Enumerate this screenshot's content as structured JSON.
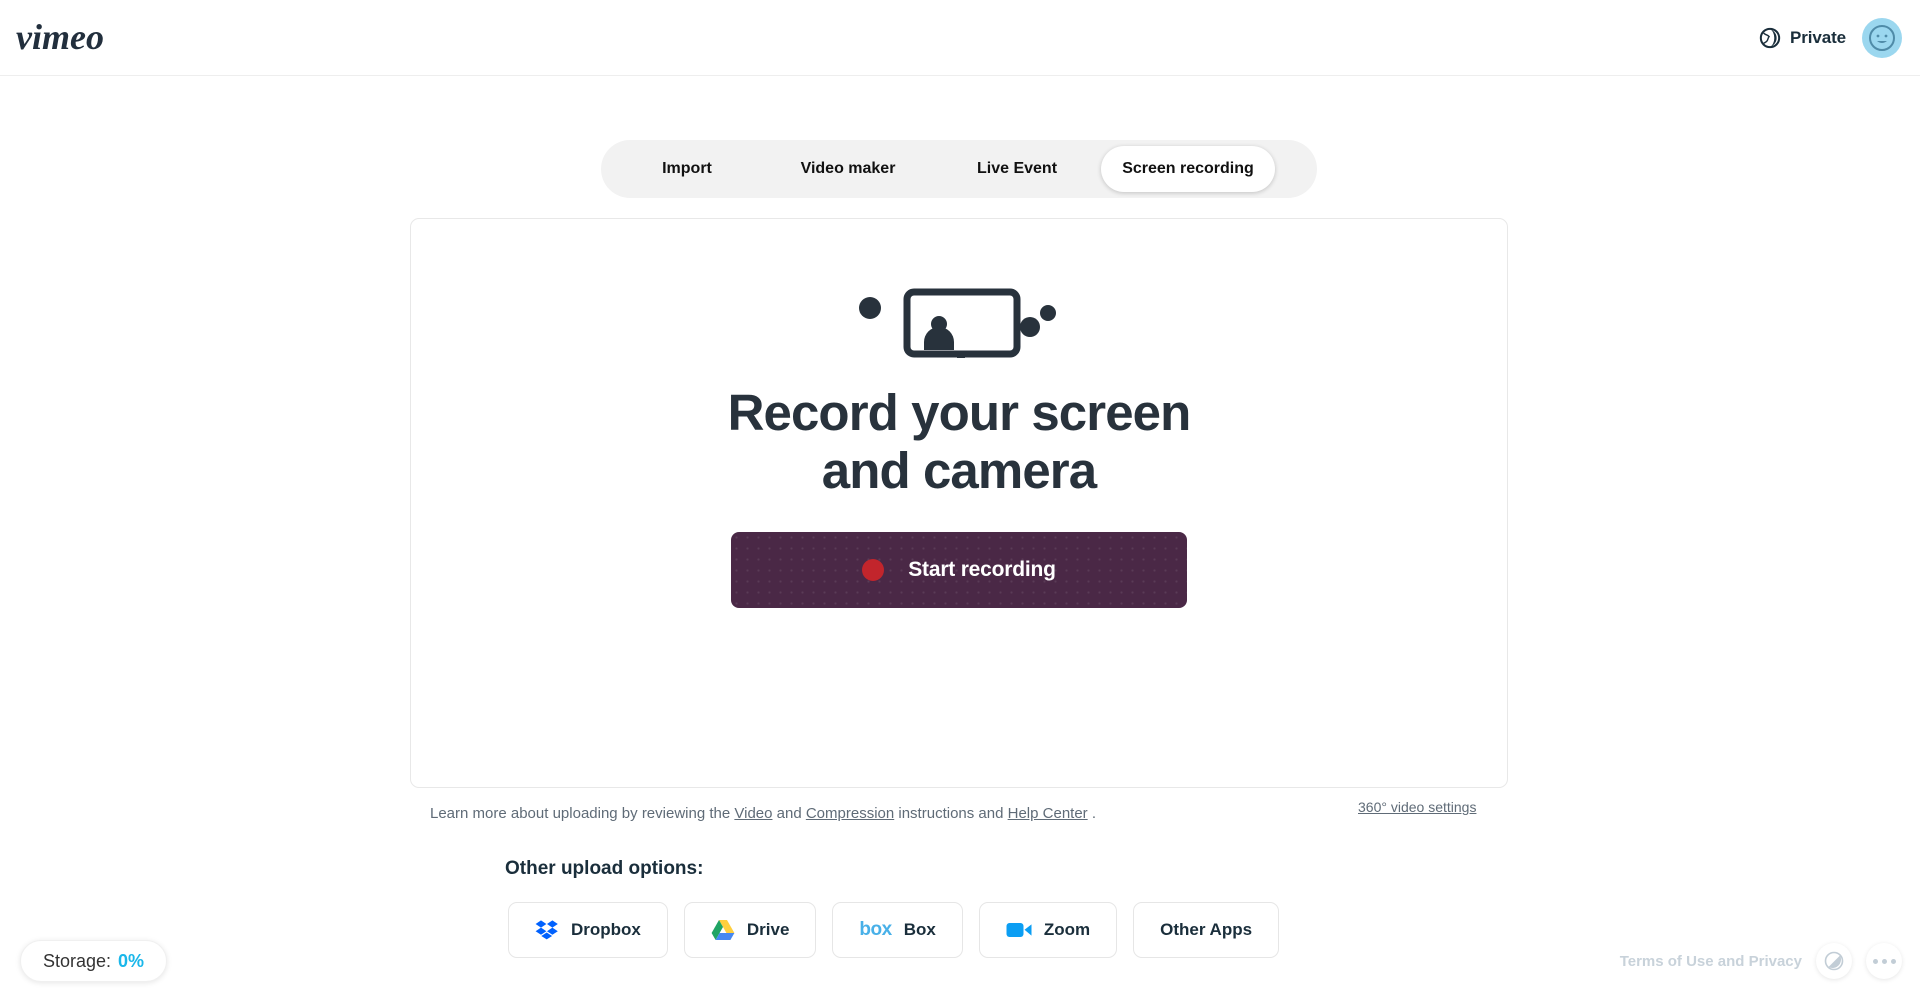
{
  "header": {
    "logo_text": "vimeo",
    "logo_icon": "vimeo-logo",
    "privacy_label": "Private",
    "privacy_icon": "globe-icon",
    "avatar_icon": "user-avatar-smiley"
  },
  "tabs": [
    {
      "label": "Import",
      "active": false
    },
    {
      "label": "Video maker",
      "active": false
    },
    {
      "label": "Live Event",
      "active": false
    },
    {
      "label": "Screen recording",
      "active": true
    }
  ],
  "main": {
    "hero_icon": "monitor-with-person-icon",
    "headline_line1": "Record your screen",
    "headline_line2": "and camera",
    "record_button_label": "Start recording",
    "record_button_icon": "record-dot-icon"
  },
  "links": {
    "learn_prefix": "Learn more about uploading by reviewing the ",
    "video_link": "Video",
    "and_1": " and ",
    "compression_link": "Compression",
    "instructions_text": " instructions and ",
    "help_center_link": "Help Center",
    "trailing_period": " .",
    "settings_360": "360° video settings"
  },
  "other_options": {
    "title": "Other upload options:",
    "buttons": [
      {
        "label": "Dropbox",
        "icon": "dropbox-icon"
      },
      {
        "label": "Drive",
        "icon": "google-drive-icon"
      },
      {
        "label": "Box",
        "icon": "box-icon"
      },
      {
        "label": "Zoom",
        "icon": "zoom-camera-icon"
      },
      {
        "label": "Other Apps",
        "icon": "none"
      }
    ]
  },
  "footer": {
    "storage_label": "Storage:",
    "storage_value": "0%",
    "terms_label": "Terms of Use and Privacy",
    "contrast_icon": "contrast-accessibility-icon",
    "more_icon": "more-dots-icon"
  },
  "colors": {
    "brand_blue": "#1ab7ea",
    "record_button_bg": "#4a2846",
    "record_dot": "#c2252c",
    "text_dark": "#28323c",
    "tabbar_bg": "#f2f2f2"
  }
}
